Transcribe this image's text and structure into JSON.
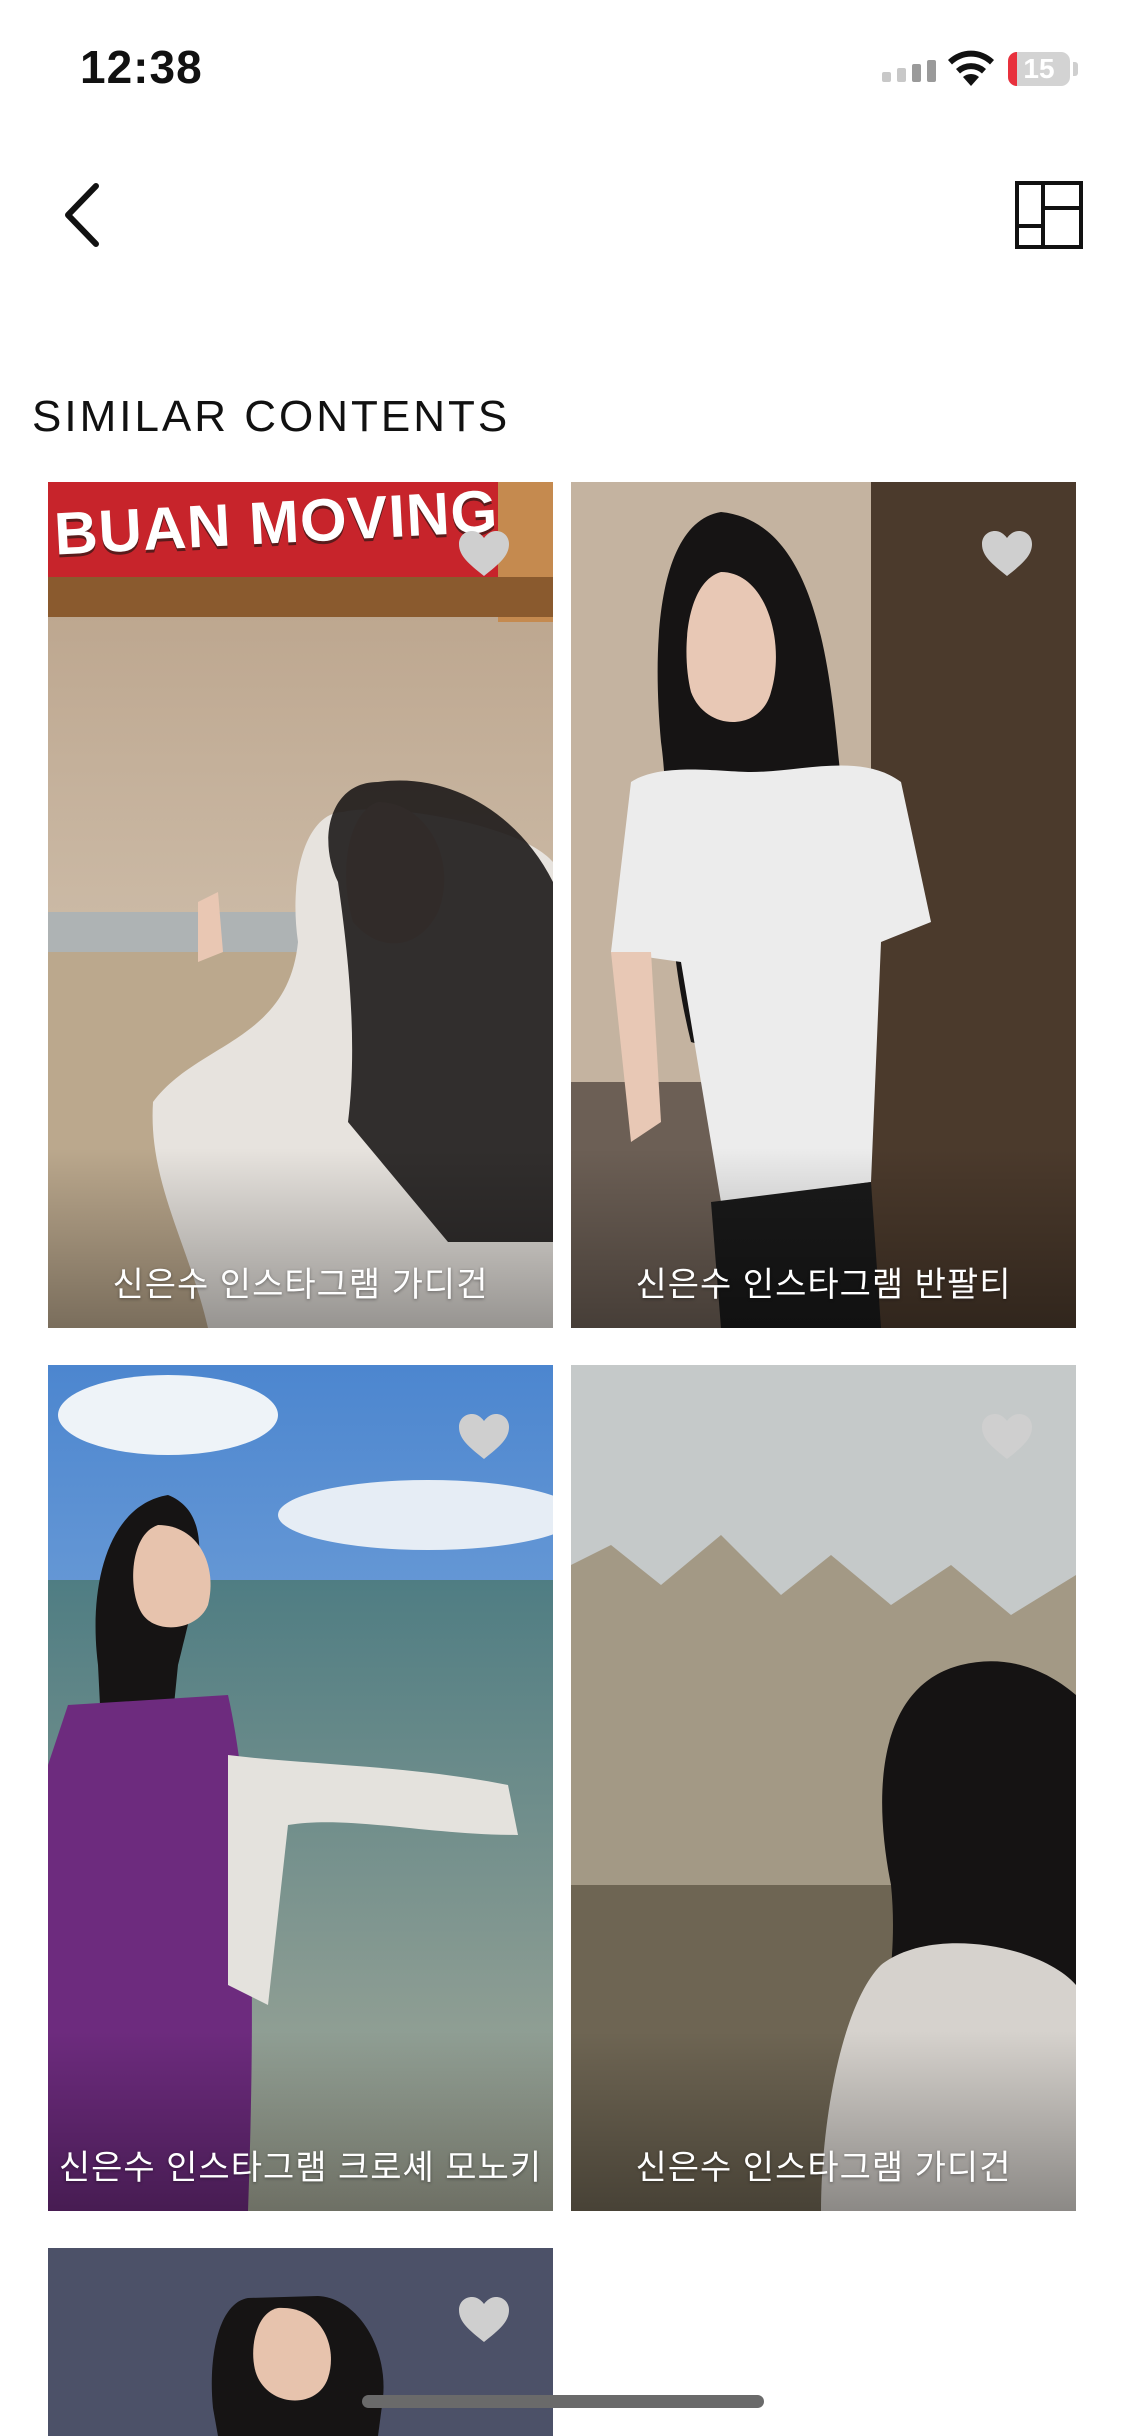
{
  "status_bar": {
    "time": "12:38",
    "battery_level": "15",
    "battery_fraction": 0.15,
    "icons": [
      "cellular-signal-icon",
      "wifi-icon",
      "battery-icon"
    ]
  },
  "nav": {
    "back_icon": "chevron-left-icon",
    "layout_icon": "grid-layout-icon"
  },
  "section": {
    "title": "SIMILAR CONTENTS"
  },
  "cards": [
    {
      "caption": "신은수 인스타그램 가디건",
      "sign_text": "BUAN MOVING",
      "heart_icon": "heart-icon"
    },
    {
      "caption": "신은수 인스타그램 반팔티",
      "heart_icon": "heart-icon"
    },
    {
      "caption": "신은수 인스타그램 크로셰 모노키",
      "heart_icon": "heart-icon"
    },
    {
      "caption": "신은수 인스타그램 가디건",
      "heart_icon": "heart-icon"
    },
    {
      "caption": "",
      "heart_icon": "heart-icon"
    }
  ],
  "colors": {
    "background": "#ffffff",
    "heart": "#cfcfcf",
    "caption_text": "#ffffff",
    "battery_low": "#e8313d"
  }
}
